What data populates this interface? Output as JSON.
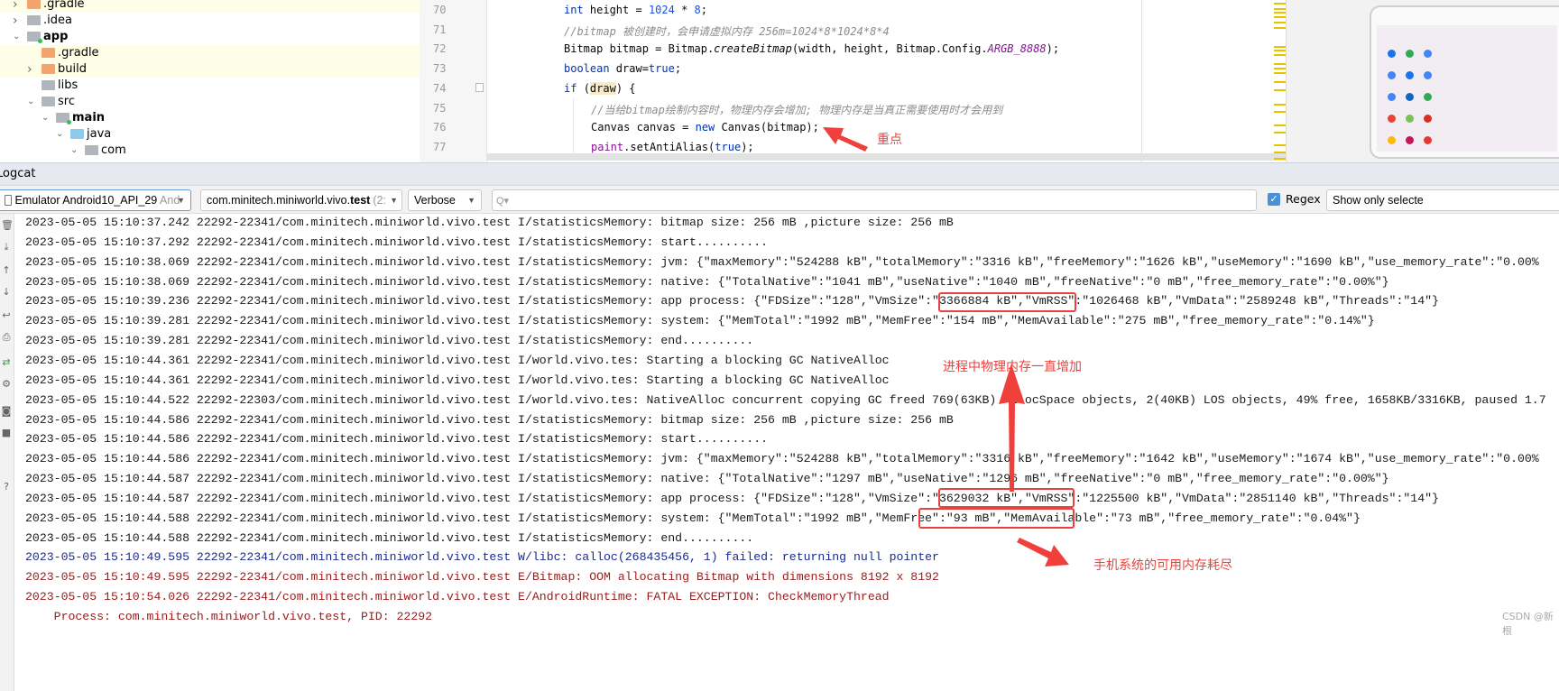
{
  "project_tree": [
    {
      "label": ".gradle",
      "depth": 0,
      "expanded": false,
      "folder": "orange",
      "bold": false,
      "highlight": true
    },
    {
      "label": ".idea",
      "depth": 0,
      "expanded": false,
      "folder": "grey",
      "bold": false,
      "highlight": false
    },
    {
      "label": "app",
      "depth": 0,
      "expanded": true,
      "folder": "module",
      "bold": true,
      "highlight": false
    },
    {
      "label": ".gradle",
      "depth": 1,
      "expanded": null,
      "folder": "orange",
      "bold": false,
      "highlight": true
    },
    {
      "label": "build",
      "depth": 1,
      "expanded": false,
      "folder": "orange",
      "bold": false,
      "highlight": true
    },
    {
      "label": "libs",
      "depth": 1,
      "expanded": null,
      "folder": "grey",
      "bold": false,
      "highlight": false
    },
    {
      "label": "src",
      "depth": 1,
      "expanded": true,
      "folder": "grey",
      "bold": false,
      "highlight": false
    },
    {
      "label": "main",
      "depth": 2,
      "expanded": true,
      "folder": "module",
      "bold": true,
      "highlight": false
    },
    {
      "label": "java",
      "depth": 3,
      "expanded": true,
      "folder": "blue",
      "bold": false,
      "highlight": false
    },
    {
      "label": "com",
      "depth": 4,
      "expanded": true,
      "folder": "package",
      "bold": false,
      "highlight": false
    }
  ],
  "editor": {
    "line_numbers": [
      "70",
      "71",
      "72",
      "73",
      "74",
      "75",
      "76",
      "77"
    ],
    "lines": [
      {
        "indent": 0,
        "tokens": [
          {
            "t": "int ",
            "c": "kw"
          },
          {
            "t": "height = ",
            "c": "p"
          },
          {
            "t": "1024",
            "c": "num"
          },
          {
            "t": " * ",
            "c": "p"
          },
          {
            "t": "8",
            "c": "num"
          },
          {
            "t": ";",
            "c": "p"
          }
        ]
      },
      {
        "indent": 0,
        "tokens": [
          {
            "t": "//bitmap 被创建时，会申请虚拟内存 256m=1024*8*1024*8*4",
            "c": "cm"
          }
        ]
      },
      {
        "indent": 0,
        "tokens": [
          {
            "t": "Bitmap bitmap = Bitmap.",
            "c": "p"
          },
          {
            "t": "createBitmap",
            "c": "it"
          },
          {
            "t": "(width, height, Bitmap.Config.",
            "c": "p"
          },
          {
            "t": "ARGB_8888",
            "c": "const"
          },
          {
            "t": ");",
            "c": "p"
          }
        ]
      },
      {
        "indent": 0,
        "tokens": [
          {
            "t": "boolean ",
            "c": "kw"
          },
          {
            "t": "draw=",
            "c": "p"
          },
          {
            "t": "true",
            "c": "kw"
          },
          {
            "t": ";",
            "c": "p"
          }
        ]
      },
      {
        "indent": 0,
        "tokens": [
          {
            "t": "if ",
            "c": "kw"
          },
          {
            "t": "(",
            "c": "p"
          },
          {
            "t": "draw",
            "c": "hl"
          },
          {
            "t": ") {",
            "c": "p"
          }
        ]
      },
      {
        "indent": 1,
        "tokens": [
          {
            "t": "//当给bitmap绘制内容时，物理内存会增加; 物理内存是当真正需要使用时才会用到",
            "c": "cm"
          }
        ]
      },
      {
        "indent": 1,
        "tokens": [
          {
            "t": "Canvas canvas = ",
            "c": "p"
          },
          {
            "t": "new ",
            "c": "kw"
          },
          {
            "t": "Canvas(bitmap);",
            "c": "p"
          }
        ]
      },
      {
        "indent": 1,
        "tokens": [
          {
            "t": "paint",
            "c": "field"
          },
          {
            "t": ".setAntiAlias(",
            "c": "p"
          },
          {
            "t": "true",
            "c": "kw"
          },
          {
            "t": ");",
            "c": "p"
          }
        ]
      }
    ]
  },
  "logcat": {
    "title": "Logcat",
    "device": "Emulator Android10_API_29",
    "device_suffix": "And",
    "package_prefix": "com.minitech.miniworld.vivo.",
    "package_bold": "test",
    "package_suffix": "(2:",
    "level": "Verbose",
    "search_value": "",
    "regex_label": "Regex",
    "regex_checked": true,
    "filter": "Show only selecte",
    "lines": [
      {
        "level": "I",
        "text": "2023-05-05 15:10:37.242 22292-22341/com.minitech.miniworld.vivo.test I/statisticsMemory: bitmap size: 256 mB ,picture size: 256 mB"
      },
      {
        "level": "I",
        "text": "2023-05-05 15:10:37.292 22292-22341/com.minitech.miniworld.vivo.test I/statisticsMemory: start.........."
      },
      {
        "level": "I",
        "text": "2023-05-05 15:10:38.069 22292-22341/com.minitech.miniworld.vivo.test I/statisticsMemory: jvm: {\"maxMemory\":\"524288 kB\",\"totalMemory\":\"3316 kB\",\"freeMemory\":\"1626 kB\",\"useMemory\":\"1690 kB\",\"use_memory_rate\":\"0.00%"
      },
      {
        "level": "I",
        "text": "2023-05-05 15:10:38.069 22292-22341/com.minitech.miniworld.vivo.test I/statisticsMemory: native: {\"TotalNative\":\"1041 mB\",\"useNative\":\"1040 mB\",\"freeNative\":\"0 mB\",\"free_memory_rate\":\"0.00%\"}"
      },
      {
        "level": "I",
        "text": "2023-05-05 15:10:39.236 22292-22341/com.minitech.miniworld.vivo.test I/statisticsMemory: app process: {\"FDSize\":\"128\",\"VmSize\":\"3366884 kB\",\"VmRSS\":\"1026468 kB\",\"VmData\":\"2589248 kB\",\"Threads\":\"14\"}"
      },
      {
        "level": "I",
        "text": "2023-05-05 15:10:39.281 22292-22341/com.minitech.miniworld.vivo.test I/statisticsMemory: system: {\"MemTotal\":\"1992 mB\",\"MemFree\":\"154 mB\",\"MemAvailable\":\"275 mB\",\"free_memory_rate\":\"0.14%\"}"
      },
      {
        "level": "I",
        "text": "2023-05-05 15:10:39.281 22292-22341/com.minitech.miniworld.vivo.test I/statisticsMemory: end.........."
      },
      {
        "level": "I",
        "text": "2023-05-05 15:10:44.361 22292-22341/com.minitech.miniworld.vivo.test I/world.vivo.tes: Starting a blocking GC NativeAlloc"
      },
      {
        "level": "I",
        "text": "2023-05-05 15:10:44.361 22292-22341/com.minitech.miniworld.vivo.test I/world.vivo.tes: Starting a blocking GC NativeAlloc"
      },
      {
        "level": "I",
        "text": "2023-05-05 15:10:44.522 22292-22303/com.minitech.miniworld.vivo.test I/world.vivo.tes: NativeAlloc concurrent copying GC freed 769(63KB) AllocSpace objects, 2(40KB) LOS objects, 49% free, 1658KB/3316KB, paused 1.7"
      },
      {
        "level": "I",
        "text": "2023-05-05 15:10:44.586 22292-22341/com.minitech.miniworld.vivo.test I/statisticsMemory: bitmap size: 256 mB ,picture size: 256 mB"
      },
      {
        "level": "I",
        "text": "2023-05-05 15:10:44.586 22292-22341/com.minitech.miniworld.vivo.test I/statisticsMemory: start.........."
      },
      {
        "level": "I",
        "text": "2023-05-05 15:10:44.586 22292-22341/com.minitech.miniworld.vivo.test I/statisticsMemory: jvm: {\"maxMemory\":\"524288 kB\",\"totalMemory\":\"3316 kB\",\"freeMemory\":\"1642 kB\",\"useMemory\":\"1674 kB\",\"use_memory_rate\":\"0.00%"
      },
      {
        "level": "I",
        "text": "2023-05-05 15:10:44.587 22292-22341/com.minitech.miniworld.vivo.test I/statisticsMemory: native: {\"TotalNative\":\"1297 mB\",\"useNative\":\"1296 mB\",\"freeNative\":\"0 mB\",\"free_memory_rate\":\"0.00%\"}"
      },
      {
        "level": "I",
        "text": "2023-05-05 15:10:44.587 22292-22341/com.minitech.miniworld.vivo.test I/statisticsMemory: app process: {\"FDSize\":\"128\",\"VmSize\":\"3629032 kB\",\"VmRSS\":\"1225500 kB\",\"VmData\":\"2851140 kB\",\"Threads\":\"14\"}"
      },
      {
        "level": "I",
        "text": "2023-05-05 15:10:44.588 22292-22341/com.minitech.miniworld.vivo.test I/statisticsMemory: system: {\"MemTotal\":\"1992 mB\",\"MemFree\":\"93 mB\",\"MemAvailable\":\"73 mB\",\"free_memory_rate\":\"0.04%\"}"
      },
      {
        "level": "I",
        "text": "2023-05-05 15:10:44.588 22292-22341/com.minitech.miniworld.vivo.test I/statisticsMemory: end.........."
      },
      {
        "level": "W",
        "text": "2023-05-05 15:10:49.595 22292-22341/com.minitech.miniworld.vivo.test W/libc: calloc(268435456, 1) failed: returning null pointer"
      },
      {
        "level": "E",
        "text": "2023-05-05 15:10:49.595 22292-22341/com.minitech.miniworld.vivo.test E/Bitmap: OOM allocating Bitmap with dimensions 8192 x 8192"
      },
      {
        "level": "E",
        "text": "2023-05-05 15:10:54.026 22292-22341/com.minitech.miniworld.vivo.test E/AndroidRuntime: FATAL EXCEPTION: CheckMemoryThread"
      },
      {
        "level": "E",
        "text": "    Process: com.minitech.miniworld.vivo.test, PID: 22292"
      }
    ]
  },
  "annotations": {
    "code_note": "重点",
    "rss_note": "进程中物理内存一直增加",
    "avail_note": "手机系统的可用内存耗尽",
    "color": "#f0403c"
  },
  "watermark": "CSDN @新根",
  "colors": {
    "keyword": "#0033b3",
    "number": "#1750eb",
    "comment": "#8c8c8c",
    "constant": "#871094",
    "error": "#9a1b1b",
    "warn": "#1c2a8f",
    "accent": "#4a90d9"
  }
}
